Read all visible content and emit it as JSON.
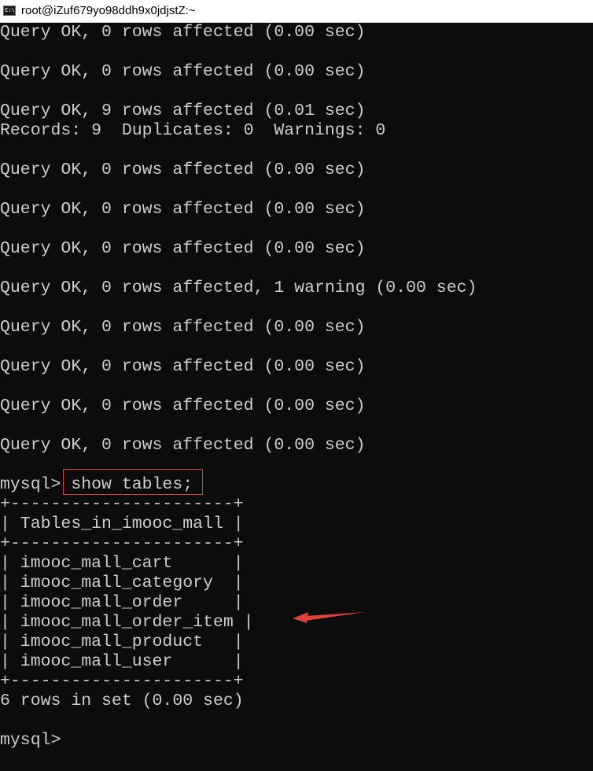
{
  "window": {
    "title": "root@iZuf679yo98ddh9x0jdjstZ:~",
    "icon": "terminal-icon",
    "icon_text": "C:\\"
  },
  "terminal": {
    "lines": [
      "Query OK, 0 rows affected (0.00 sec)",
      "",
      "Query OK, 0 rows affected (0.00 sec)",
      "",
      "Query OK, 9 rows affected (0.01 sec)",
      "Records: 9  Duplicates: 0  Warnings: 0",
      "",
      "Query OK, 0 rows affected (0.00 sec)",
      "",
      "Query OK, 0 rows affected (0.00 sec)",
      "",
      "Query OK, 0 rows affected (0.00 sec)",
      "",
      "Query OK, 0 rows affected, 1 warning (0.00 sec)",
      "",
      "Query OK, 0 rows affected (0.00 sec)",
      "",
      "Query OK, 0 rows affected (0.00 sec)",
      "",
      "Query OK, 0 rows affected (0.00 sec)",
      "",
      "Query OK, 0 rows affected (0.00 sec)",
      "",
      "mysql> show tables;",
      "+----------------------+",
      "| Tables_in_imooc_mall |",
      "+----------------------+",
      "| imooc_mall_cart      |",
      "| imooc_mall_category  |",
      "| imooc_mall_order     |",
      "| imooc_mall_order_item |",
      "| imooc_mall_product   |",
      "| imooc_mall_user      |",
      "+----------------------+",
      "6 rows in set (0.00 sec)",
      "",
      "mysql>"
    ]
  },
  "annotations": {
    "highlight_color": "#e0403a"
  }
}
